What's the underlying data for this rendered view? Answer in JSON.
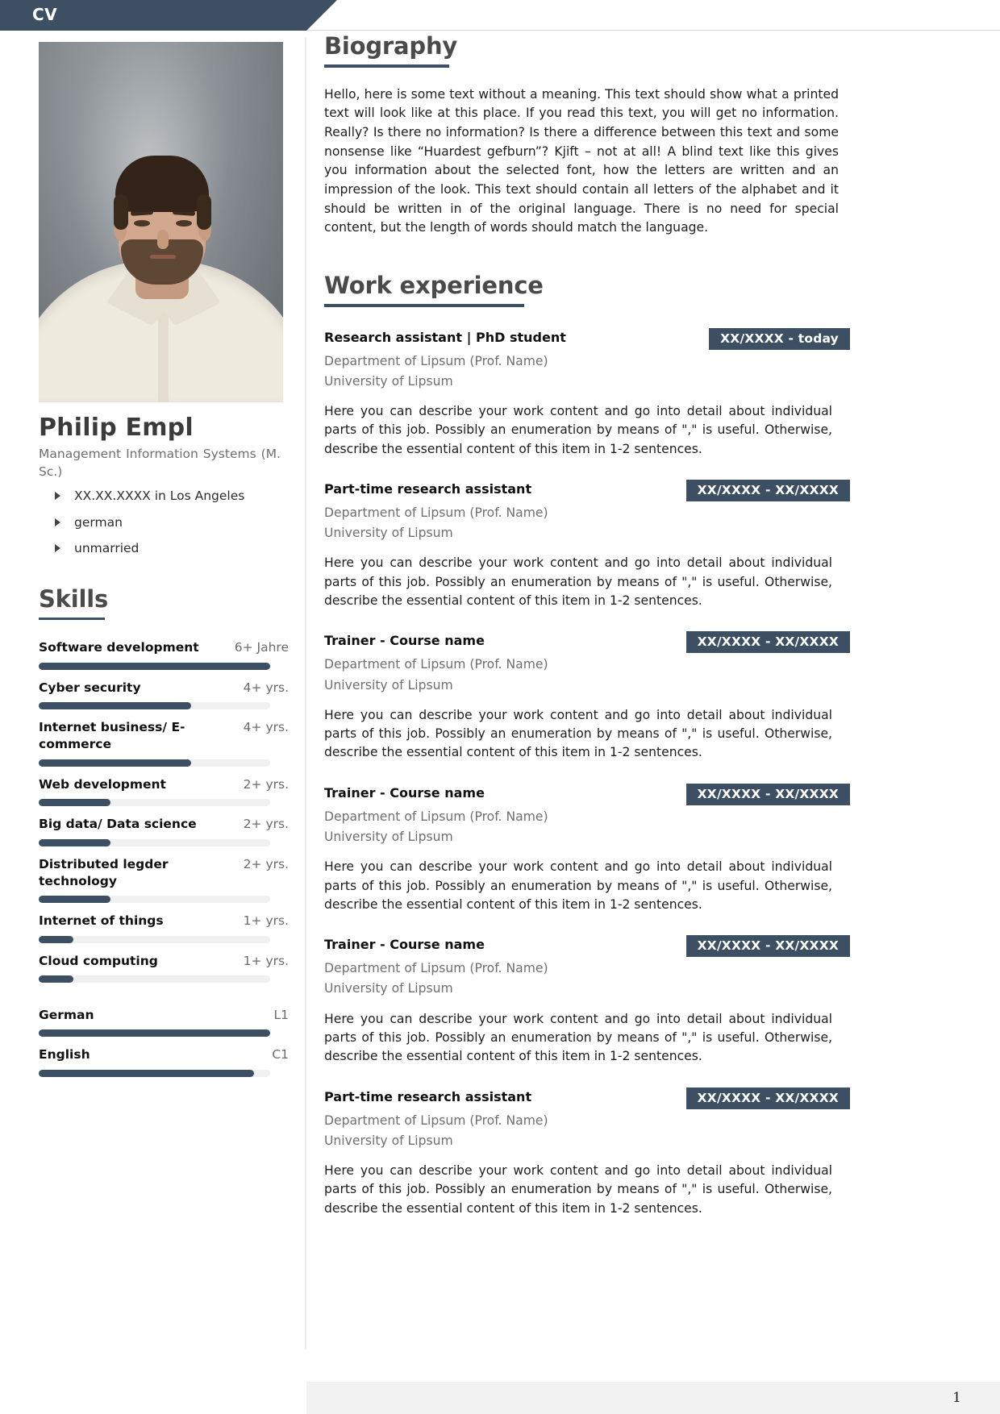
{
  "document": {
    "header_label": "CV",
    "page_number": "1",
    "accent_color": "#3d4f63",
    "track_color": "#f0f0f0"
  },
  "profile": {
    "photo_alt": "portrait-photo",
    "name": "Philip Empl",
    "subtitle": "Management Information Systems (M. Sc.)",
    "facts": [
      "XX.XX.XXXX in Los Angeles",
      "german",
      "unmarried"
    ]
  },
  "skills_section": {
    "heading": "Skills",
    "items": [
      {
        "name": "Software development",
        "years": "6+ Jahre",
        "percent": 100
      },
      {
        "name": "Cyber security",
        "years": "4+ yrs.",
        "percent": 66
      },
      {
        "name": "Internet business/ E-commerce",
        "years": "4+ yrs.",
        "percent": 66
      },
      {
        "name": "Web development",
        "years": "2+ yrs.",
        "percent": 31
      },
      {
        "name": "Big data/ Data science",
        "years": "2+ yrs.",
        "percent": 31
      },
      {
        "name": "Distributed legder technology",
        "years": "2+ yrs.",
        "percent": 31
      },
      {
        "name": "Internet of things",
        "years": "1+ yrs.",
        "percent": 15
      },
      {
        "name": "Cloud computing",
        "years": "1+ yrs.",
        "percent": 15
      }
    ],
    "languages": [
      {
        "name": "German",
        "level": "L1",
        "percent": 100
      },
      {
        "name": "English",
        "level": "C1",
        "percent": 93
      }
    ]
  },
  "biography": {
    "heading": "Biography",
    "text": "Hello, here is some text without a meaning. This text should show what a printed text will look like at this place. If you read this text, you will get no information. Really? Is there no information? Is there a difference between this text and some nonsense like “Huardest gefburn”? Kjift – not at all! A blind text like this gives you information about the selected font, how the letters are written and an impression of the look. This text should contain all letters of the alphabet and it should be written in of the original language. There is no need for special content, but the length of words should match the language."
  },
  "work": {
    "heading": "Work experience",
    "items": [
      {
        "title": "Research assistant | PhD student",
        "date": "XX/XXXX - today",
        "org_line1": "Department of Lipsum (Prof. Name)",
        "org_line2": "University of Lipsum",
        "description": "Here you can describe your work content and go into detail about individual parts of this job. Possibly an enumeration by means of \",\" is useful. Otherwise, describe the essential content of this item in 1-2 sentences."
      },
      {
        "title": "Part-time research assistant",
        "date": "XX/XXXX - XX/XXXX",
        "org_line1": "Department of Lipsum (Prof. Name)",
        "org_line2": "University of Lipsum",
        "description": "Here you can describe your work content and go into detail about individual parts of this job. Possibly an enumeration by means of \",\" is useful. Otherwise, describe the essential content of this item in 1-2 sentences."
      },
      {
        "title": "Trainer - Course name",
        "date": "XX/XXXX - XX/XXXX",
        "org_line1": "Department of Lipsum (Prof. Name)",
        "org_line2": "University of Lipsum",
        "description": "Here you can describe your work content and go into detail about individual parts of this job. Possibly an enumeration by means of \",\" is useful. Otherwise, describe the essential content of this item in 1-2 sentences."
      },
      {
        "title": "Trainer - Course name",
        "date": "XX/XXXX - XX/XXXX",
        "org_line1": "Department of Lipsum (Prof. Name)",
        "org_line2": "University of Lipsum",
        "description": "Here you can describe your work content and go into detail about individual parts of this job. Possibly an enumeration by means of \",\" is useful. Otherwise, describe the essential content of this item in 1-2 sentences."
      },
      {
        "title": "Trainer - Course name",
        "date": "XX/XXXX - XX/XXXX",
        "org_line1": "Department of Lipsum (Prof. Name)",
        "org_line2": "University of Lipsum",
        "description": "Here you can describe your work content and go into detail about individual parts of this job. Possibly an enumeration by means of \",\" is useful. Otherwise, describe the essential content of this item in 1-2 sentences."
      },
      {
        "title": "Part-time research assistant",
        "date": "XX/XXXX - XX/XXXX",
        "org_line1": "Department of Lipsum (Prof. Name)",
        "org_line2": "University of Lipsum",
        "description": "Here you can describe your work content and go into detail about individual parts of this job. Possibly an enumeration by means of \",\" is useful. Otherwise, describe the essential content of this item in 1-2 sentences."
      }
    ]
  }
}
